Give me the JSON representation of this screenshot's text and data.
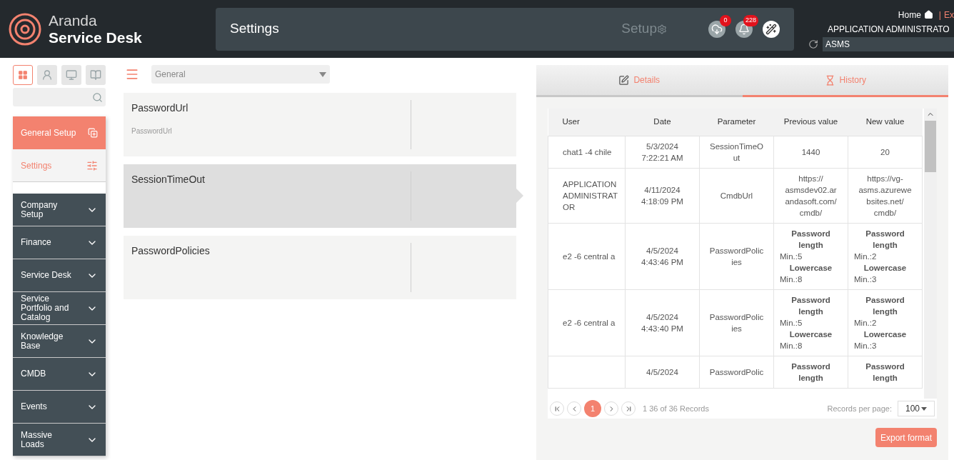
{
  "header": {
    "logo_line1": "Aranda",
    "logo_line2": "Service Desk",
    "page_title": "Settings",
    "section": "Setup",
    "badges": [
      {
        "kind": "cloud",
        "count": "0"
      },
      {
        "kind": "bell",
        "count": "228"
      },
      {
        "kind": "wand"
      }
    ],
    "home": "Home",
    "separator": "|",
    "exit": "Ex",
    "user": "APPLICATION ADMINISTRATO",
    "instance": "ASMS"
  },
  "sidebar": {
    "view_buttons": [
      {
        "kind": "grid",
        "selected": true
      },
      {
        "kind": "agent",
        "selected": false
      },
      {
        "kind": "monitor",
        "selected": false
      },
      {
        "kind": "book",
        "selected": false
      }
    ],
    "items": [
      {
        "label": "General Setup",
        "kind": "header",
        "expanded": true
      },
      {
        "label": "Settings",
        "kind": "link",
        "selected": true
      },
      {
        "label": "Company Setup",
        "kind": "group",
        "expanded": false
      },
      {
        "label": "Finance",
        "kind": "group",
        "expanded": false
      },
      {
        "label": "Service Desk",
        "kind": "group",
        "expanded": false
      },
      {
        "label": "Service Portfolio and Catalog",
        "kind": "group",
        "expanded": false
      },
      {
        "label": "Knowledge Base",
        "kind": "group",
        "expanded": false
      },
      {
        "label": "CMDB",
        "kind": "group",
        "expanded": false
      },
      {
        "label": "Events",
        "kind": "group",
        "expanded": false
      },
      {
        "label": "Massive Loads",
        "kind": "group",
        "expanded": false
      }
    ]
  },
  "settings": {
    "filter": "General",
    "cards": [
      {
        "title": "PasswordUrl",
        "subtitle": "PasswordUrl",
        "selected": false
      },
      {
        "title": "SessionTimeOut",
        "selected": true
      },
      {
        "title": "PasswordPolicies",
        "selected": false
      }
    ]
  },
  "detail": {
    "tabs": [
      {
        "label": "Details",
        "kind": "edit",
        "selected": false
      },
      {
        "label": "History",
        "kind": "hourglass",
        "selected": true
      }
    ],
    "table": {
      "columns": [
        "User",
        "Date",
        "Parameter",
        "Previous value",
        "New value"
      ],
      "rows": [
        [
          [
            "chat1  -4 chile"
          ],
          [
            "5/3/2024",
            "7:22:21 AM"
          ],
          [
            "SessionTimeO",
            "ut"
          ],
          [
            "1440"
          ],
          [
            "20"
          ]
        ],
        [
          [
            "APPLICATION",
            "ADMINISTRAT",
            "OR"
          ],
          [
            "4/11/2024",
            "4:18:09 PM"
          ],
          [
            "CmdbUrl"
          ],
          [
            "https://",
            "asmsdev02.ar",
            "andasoft.com/",
            "cmdb/"
          ],
          [
            "https://vg-",
            "asms.azurewe",
            "bsites.net/",
            "cmdb/"
          ]
        ],
        [
          [
            "e2 -6 central a"
          ],
          [
            "4/5/2024",
            "4:43:46 PM"
          ],
          [
            "PasswordPolic",
            "ies"
          ],
          [
            {
              "text": "Password length",
              "bold": true
            },
            {
              "text": "Min.:5",
              "bold": false
            },
            {
              "text": "Lowercase",
              "bold": true
            },
            {
              "text": "Min.:8",
              "bold": false
            }
          ],
          [
            {
              "text": "Password length",
              "bold": true
            },
            {
              "text": "Min.:2",
              "bold": false
            },
            {
              "text": "Lowercase",
              "bold": true
            },
            {
              "text": "Min.:3",
              "bold": false
            }
          ]
        ],
        [
          [
            "e2 -6 central a"
          ],
          [
            "4/5/2024",
            "4:43:40 PM"
          ],
          [
            "PasswordPolic",
            "ies"
          ],
          [
            {
              "text": "Password length",
              "bold": true
            },
            {
              "text": "Min.:5",
              "bold": false
            },
            {
              "text": "Lowercase",
              "bold": true
            },
            {
              "text": "Min.:8",
              "bold": false
            }
          ],
          [
            {
              "text": "Password length",
              "bold": true
            },
            {
              "text": "Min.:2",
              "bold": false
            },
            {
              "text": "Lowercase",
              "bold": true
            },
            {
              "text": "Min.:3",
              "bold": false
            }
          ]
        ],
        [
          [],
          [
            "4/5/2024"
          ],
          [
            "PasswordPolic"
          ],
          [
            {
              "text": "Password length",
              "bold": true
            }
          ],
          [
            {
              "text": "Password length",
              "bold": true
            }
          ]
        ]
      ]
    },
    "pagination": {
      "page": "1",
      "info": "1 36 of 36 Records",
      "per_page_label": "Records per page:",
      "per_page": "100"
    },
    "export_button": "Export format"
  }
}
